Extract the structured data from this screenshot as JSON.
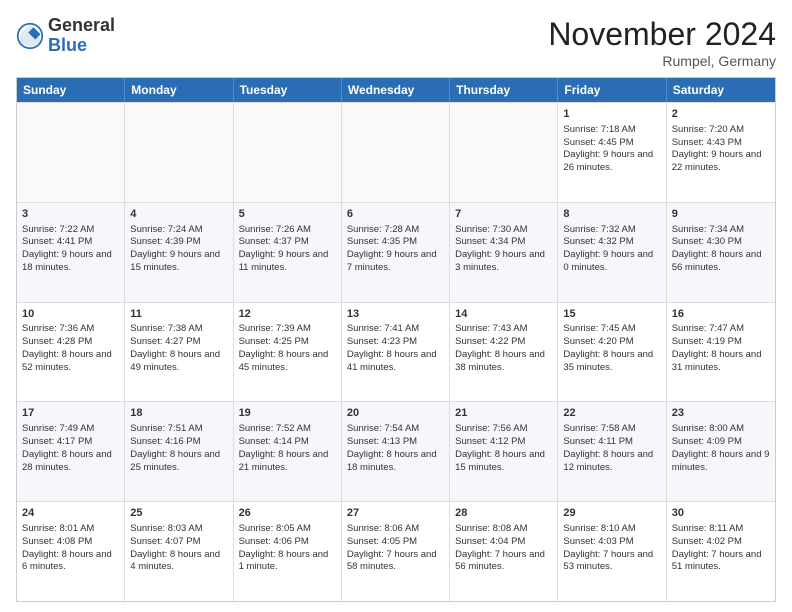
{
  "header": {
    "logo_general": "General",
    "logo_blue": "Blue",
    "month_title": "November 2024",
    "location": "Rumpel, Germany"
  },
  "weekdays": [
    "Sunday",
    "Monday",
    "Tuesday",
    "Wednesday",
    "Thursday",
    "Friday",
    "Saturday"
  ],
  "rows": [
    [
      {
        "day": "",
        "info": ""
      },
      {
        "day": "",
        "info": ""
      },
      {
        "day": "",
        "info": ""
      },
      {
        "day": "",
        "info": ""
      },
      {
        "day": "",
        "info": ""
      },
      {
        "day": "1",
        "info": "Sunrise: 7:18 AM\nSunset: 4:45 PM\nDaylight: 9 hours and 26 minutes."
      },
      {
        "day": "2",
        "info": "Sunrise: 7:20 AM\nSunset: 4:43 PM\nDaylight: 9 hours and 22 minutes."
      }
    ],
    [
      {
        "day": "3",
        "info": "Sunrise: 7:22 AM\nSunset: 4:41 PM\nDaylight: 9 hours and 18 minutes."
      },
      {
        "day": "4",
        "info": "Sunrise: 7:24 AM\nSunset: 4:39 PM\nDaylight: 9 hours and 15 minutes."
      },
      {
        "day": "5",
        "info": "Sunrise: 7:26 AM\nSunset: 4:37 PM\nDaylight: 9 hours and 11 minutes."
      },
      {
        "day": "6",
        "info": "Sunrise: 7:28 AM\nSunset: 4:35 PM\nDaylight: 9 hours and 7 minutes."
      },
      {
        "day": "7",
        "info": "Sunrise: 7:30 AM\nSunset: 4:34 PM\nDaylight: 9 hours and 3 minutes."
      },
      {
        "day": "8",
        "info": "Sunrise: 7:32 AM\nSunset: 4:32 PM\nDaylight: 9 hours and 0 minutes."
      },
      {
        "day": "9",
        "info": "Sunrise: 7:34 AM\nSunset: 4:30 PM\nDaylight: 8 hours and 56 minutes."
      }
    ],
    [
      {
        "day": "10",
        "info": "Sunrise: 7:36 AM\nSunset: 4:28 PM\nDaylight: 8 hours and 52 minutes."
      },
      {
        "day": "11",
        "info": "Sunrise: 7:38 AM\nSunset: 4:27 PM\nDaylight: 8 hours and 49 minutes."
      },
      {
        "day": "12",
        "info": "Sunrise: 7:39 AM\nSunset: 4:25 PM\nDaylight: 8 hours and 45 minutes."
      },
      {
        "day": "13",
        "info": "Sunrise: 7:41 AM\nSunset: 4:23 PM\nDaylight: 8 hours and 41 minutes."
      },
      {
        "day": "14",
        "info": "Sunrise: 7:43 AM\nSunset: 4:22 PM\nDaylight: 8 hours and 38 minutes."
      },
      {
        "day": "15",
        "info": "Sunrise: 7:45 AM\nSunset: 4:20 PM\nDaylight: 8 hours and 35 minutes."
      },
      {
        "day": "16",
        "info": "Sunrise: 7:47 AM\nSunset: 4:19 PM\nDaylight: 8 hours and 31 minutes."
      }
    ],
    [
      {
        "day": "17",
        "info": "Sunrise: 7:49 AM\nSunset: 4:17 PM\nDaylight: 8 hours and 28 minutes."
      },
      {
        "day": "18",
        "info": "Sunrise: 7:51 AM\nSunset: 4:16 PM\nDaylight: 8 hours and 25 minutes."
      },
      {
        "day": "19",
        "info": "Sunrise: 7:52 AM\nSunset: 4:14 PM\nDaylight: 8 hours and 21 minutes."
      },
      {
        "day": "20",
        "info": "Sunrise: 7:54 AM\nSunset: 4:13 PM\nDaylight: 8 hours and 18 minutes."
      },
      {
        "day": "21",
        "info": "Sunrise: 7:56 AM\nSunset: 4:12 PM\nDaylight: 8 hours and 15 minutes."
      },
      {
        "day": "22",
        "info": "Sunrise: 7:58 AM\nSunset: 4:11 PM\nDaylight: 8 hours and 12 minutes."
      },
      {
        "day": "23",
        "info": "Sunrise: 8:00 AM\nSunset: 4:09 PM\nDaylight: 8 hours and 9 minutes."
      }
    ],
    [
      {
        "day": "24",
        "info": "Sunrise: 8:01 AM\nSunset: 4:08 PM\nDaylight: 8 hours and 6 minutes."
      },
      {
        "day": "25",
        "info": "Sunrise: 8:03 AM\nSunset: 4:07 PM\nDaylight: 8 hours and 4 minutes."
      },
      {
        "day": "26",
        "info": "Sunrise: 8:05 AM\nSunset: 4:06 PM\nDaylight: 8 hours and 1 minute."
      },
      {
        "day": "27",
        "info": "Sunrise: 8:06 AM\nSunset: 4:05 PM\nDaylight: 7 hours and 58 minutes."
      },
      {
        "day": "28",
        "info": "Sunrise: 8:08 AM\nSunset: 4:04 PM\nDaylight: 7 hours and 56 minutes."
      },
      {
        "day": "29",
        "info": "Sunrise: 8:10 AM\nSunset: 4:03 PM\nDaylight: 7 hours and 53 minutes."
      },
      {
        "day": "30",
        "info": "Sunrise: 8:11 AM\nSunset: 4:02 PM\nDaylight: 7 hours and 51 minutes."
      }
    ]
  ]
}
